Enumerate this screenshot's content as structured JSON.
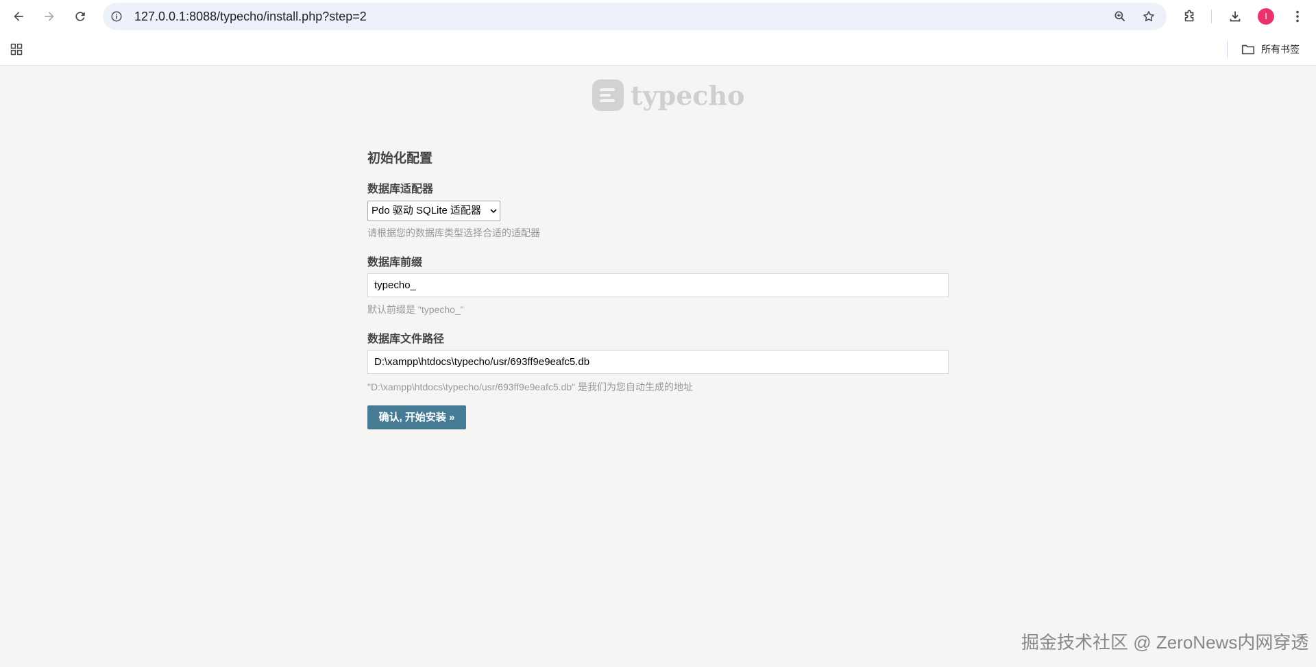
{
  "browser": {
    "url": "127.0.0.1:8088/typecho/install.php?step=2",
    "avatar_letter": "I",
    "avatar_color": "#e8336d",
    "bookmarks_folder": "所有书签",
    "icons": [
      "back-icon",
      "forward-icon",
      "reload-icon",
      "site-info-icon",
      "zoom-icon",
      "bookmark-star-icon",
      "extensions-icon",
      "download-icon",
      "menu-icon",
      "apps-grid-icon",
      "folder-icon"
    ]
  },
  "logo": {
    "text": "typecho"
  },
  "form": {
    "title": "初始化配置",
    "adapter": {
      "label": "数据库适配器",
      "selected": "Pdo 驱动 SQLite 适配器",
      "hint": "请根据您的数据库类型选择合适的适配器"
    },
    "prefix": {
      "label": "数据库前缀",
      "value": "typecho_",
      "hint": "默认前缀是 \"typecho_\""
    },
    "db_path": {
      "label": "数据库文件路径",
      "value": "D:\\xampp\\htdocs\\typecho/usr/693ff9e9eafc5.db",
      "hint": "\"D:\\xampp\\htdocs\\typecho/usr/693ff9e9eafc5.db\" 是我们为您自动生成的地址"
    },
    "submit_label": "确认, 开始安装 »"
  },
  "colors": {
    "accent": "#467b96",
    "page_bg": "#f5f5f4"
  },
  "watermark": "掘金技术社区 @ ZeroNews内网穿透"
}
